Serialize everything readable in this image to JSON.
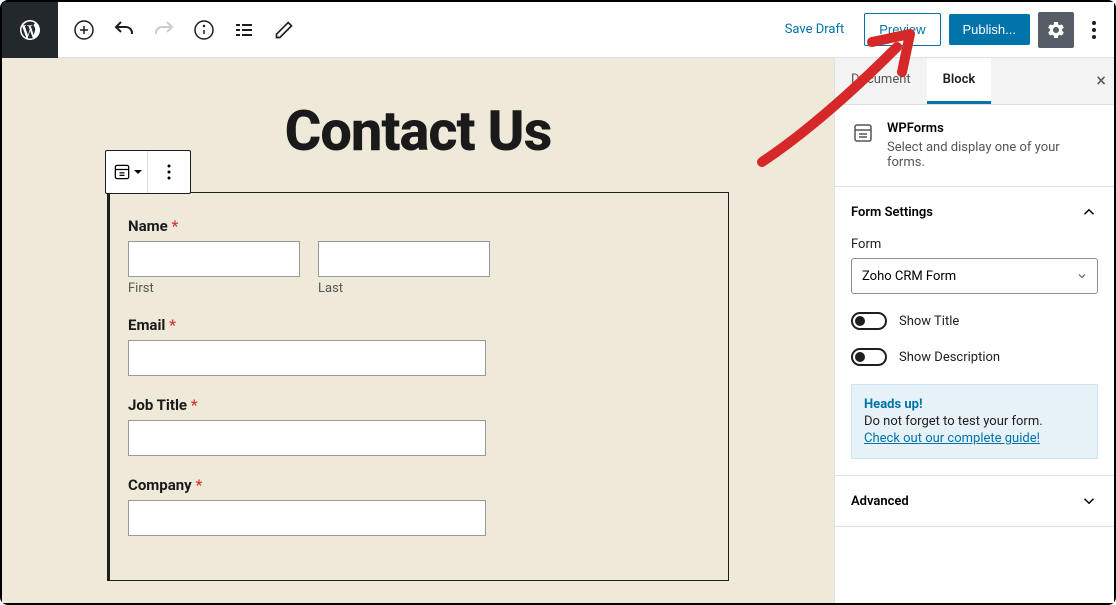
{
  "toolbar": {
    "save_draft": "Save Draft",
    "preview": "Preview",
    "publish": "Publish..."
  },
  "editor": {
    "page_title": "Contact Us",
    "form": {
      "name_label": "Name",
      "first_sublabel": "First",
      "last_sublabel": "Last",
      "email_label": "Email",
      "job_title_label": "Job Title",
      "company_label": "Company"
    }
  },
  "sidebar": {
    "tabs": {
      "document": "Document",
      "block": "Block"
    },
    "block_info": {
      "name": "WPForms",
      "desc": "Select and display one of your forms."
    },
    "panels": {
      "form_settings": {
        "title": "Form Settings",
        "form_label": "Form",
        "form_selected": "Zoho CRM Form",
        "show_title": "Show Title",
        "show_description": "Show Description",
        "notice_title": "Heads up!",
        "notice_text": "Do not forget to test your form.",
        "notice_link": "Check out our complete guide!"
      },
      "advanced": {
        "title": "Advanced"
      }
    }
  }
}
